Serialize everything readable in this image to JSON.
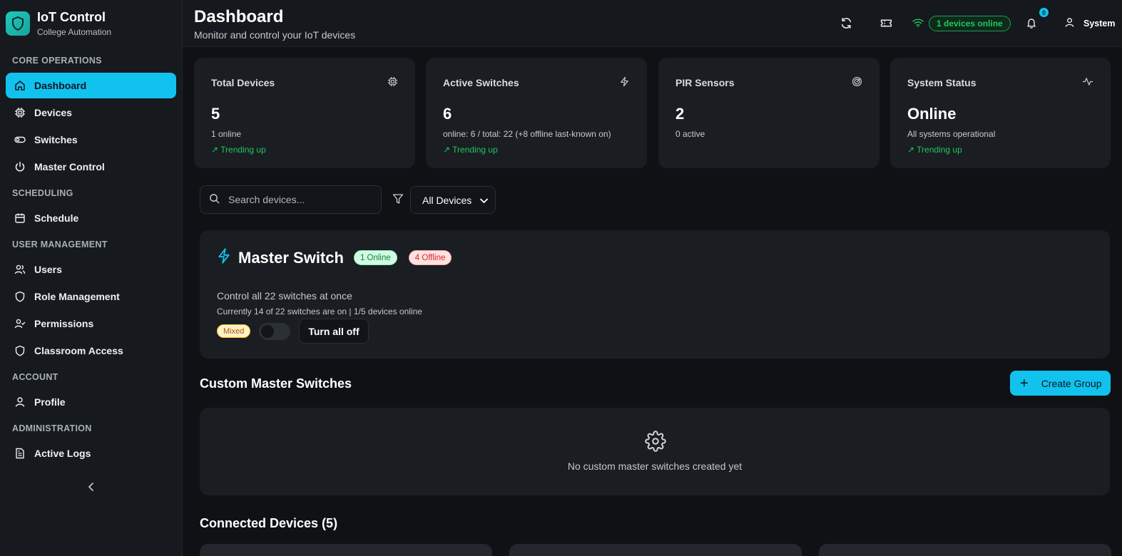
{
  "brand": {
    "title": "IoT Control",
    "subtitle": "College Automation"
  },
  "sidebar": {
    "sections": [
      {
        "label": "CORE OPERATIONS",
        "items": [
          "Dashboard",
          "Devices",
          "Switches",
          "Master Control"
        ]
      },
      {
        "label": "SCHEDULING",
        "items": [
          "Schedule"
        ]
      },
      {
        "label": "USER MANAGEMENT",
        "items": [
          "Users",
          "Role Management",
          "Permissions",
          "Classroom Access"
        ]
      },
      {
        "label": "ACCOUNT",
        "items": [
          "Profile"
        ]
      },
      {
        "label": "ADMINISTRATION",
        "items": [
          "Active Logs"
        ]
      }
    ],
    "active": "Dashboard"
  },
  "header": {
    "title": "Dashboard",
    "subtitle": "Monitor and control your IoT devices",
    "online_label": "1 devices online",
    "notif_count": "0",
    "user": "System"
  },
  "stats": [
    {
      "title": "Total Devices",
      "value": "5",
      "sub": "1 online",
      "trend": "↗ Trending up",
      "icon": "cpu-icon"
    },
    {
      "title": "Active Switches",
      "value": "6",
      "sub": "online: 6 / total: 22 (+8 offline last-known on)",
      "trend": "↗ Trending up",
      "icon": "zap-icon"
    },
    {
      "title": "PIR Sensors",
      "value": "2",
      "sub": "0 active",
      "trend": "",
      "icon": "radar-icon"
    },
    {
      "title": "System Status",
      "value": "Online",
      "sub": "All systems operational",
      "trend": "↗ Trending up",
      "icon": "activity-icon"
    }
  ],
  "search": {
    "placeholder": "Search devices..."
  },
  "filter": {
    "selected": "All Devices"
  },
  "master": {
    "title": "Master Switch",
    "online_badge": "1 Online",
    "offline_badge": "4 Offline",
    "description": "Control all 22 switches at once",
    "note": "Currently 14 of 22 switches are on | 1/5 devices online",
    "state_badge": "Mixed",
    "button": "Turn all off"
  },
  "custom": {
    "title": "Custom Master Switches",
    "create_label": "Create Group",
    "empty_text": "No custom master switches created yet"
  },
  "connected": {
    "title": "Connected Devices (5)"
  },
  "colors": {
    "accent": "#12c2ee",
    "success": "#22c55e",
    "danger": "#dc2626",
    "surface": "#1a1d22",
    "background": "#0f1114"
  }
}
